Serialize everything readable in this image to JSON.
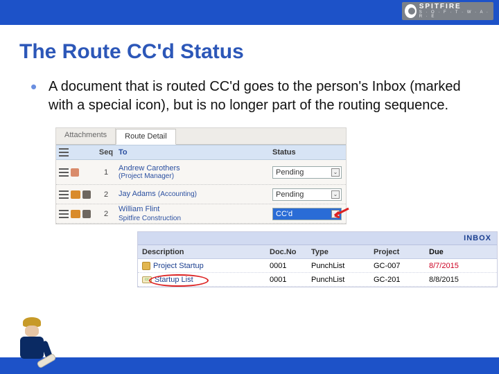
{
  "logo": {
    "brand": "SPITFIRE",
    "sub": "S · O · F · T · W · A · R · E"
  },
  "title": "The Route CC'd Status",
  "bullet": "A document that is routed CC'd goes to the person's Inbox (marked with a special icon), but is no longer part of the routing sequence.",
  "route_panel": {
    "tabs": {
      "attachments": "Attachments",
      "route_detail": "Route Detail"
    },
    "headers": {
      "seq": "Seq",
      "to": "To",
      "status": "Status"
    },
    "rows": [
      {
        "seq": "1",
        "to_name": "Andrew Carothers",
        "to_role": "(Project Manager)",
        "status": "Pending"
      },
      {
        "seq": "2",
        "to_name": "Jay Adams",
        "to_role": "(Accounting)",
        "status": "Pending"
      },
      {
        "seq": "2",
        "to_name": "William Flint",
        "to_role": "Spitfire Construction",
        "status": "CC'd"
      }
    ]
  },
  "inbox_panel": {
    "title": "INBOX",
    "headers": {
      "desc": "Description",
      "docno": "Doc.No",
      "type": "Type",
      "project": "Project",
      "due": "Due"
    },
    "rows": [
      {
        "desc": "Project Startup",
        "docno": "0001",
        "type": "PunchList",
        "project": "GC-007",
        "due": "8/7/2015"
      },
      {
        "desc": "Startup List",
        "docno": "0001",
        "type": "PunchList",
        "project": "GC-201",
        "due": "8/8/2015"
      }
    ]
  }
}
